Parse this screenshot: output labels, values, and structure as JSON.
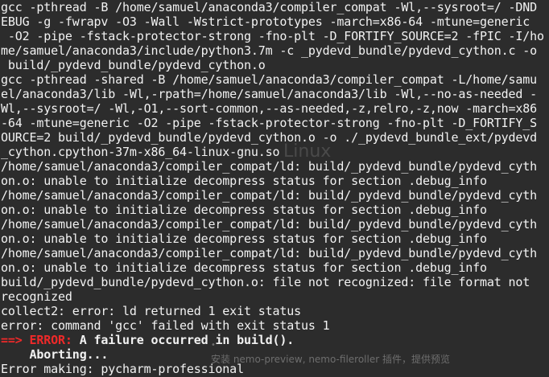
{
  "terminal": {
    "lines": [
      {
        "segments": [
          {
            "text": "gcc -pthread -B /home/samuel/anaconda3/compiler_compat -Wl,--sysroot=/ -DND"
          }
        ]
      },
      {
        "segments": [
          {
            "text": "EBUG -g -fwrapv -O3 -Wall -Wstrict-prototypes -march=x86-64 -mtune=generic"
          }
        ]
      },
      {
        "segments": [
          {
            "text": " -O2 -pipe -fstack-protector-strong -fno-plt -D_FORTIFY_SOURCE=2 -fPIC -I/ho"
          }
        ]
      },
      {
        "segments": [
          {
            "text": "me/samuel/anaconda3/include/python3.7m -c _pydevd_bundle/pydevd_cython.c -o"
          }
        ]
      },
      {
        "segments": [
          {
            "text": " build/_pydevd_bundle/pydevd_cython.o"
          }
        ]
      },
      {
        "segments": [
          {
            "text": "gcc -pthread -shared -B /home/samuel/anaconda3/compiler_compat -L/home/samu"
          }
        ]
      },
      {
        "segments": [
          {
            "text": "el/anaconda3/lib -Wl,-rpath=/home/samuel/anaconda3/lib -Wl,--no-as-needed -"
          }
        ]
      },
      {
        "segments": [
          {
            "text": "Wl,--sysroot=/ -Wl,-O1,--sort-common,--as-needed,-z,relro,-z,now -march=x86"
          }
        ]
      },
      {
        "segments": [
          {
            "text": "-64 -mtune=generic -O2 -pipe -fstack-protector-strong -fno-plt -D_FORTIFY_S"
          }
        ]
      },
      {
        "segments": [
          {
            "text": "OURCE=2 build/_pydevd_bundle/pydevd_cython.o -o ./_pydevd_bundle_ext/pydevd"
          }
        ]
      },
      {
        "segments": [
          {
            "text": "_cython.cpython-37m-x86_64-linux-gnu.so"
          }
        ]
      },
      {
        "segments": [
          {
            "text": "/home/samuel/anaconda3/compiler_compat/ld: build/_pydevd_bundle/pydevd_cyth"
          }
        ]
      },
      {
        "segments": [
          {
            "text": "on.o: unable to initialize decompress status for section .debug_info"
          }
        ]
      },
      {
        "segments": [
          {
            "text": "/home/samuel/anaconda3/compiler_compat/ld: build/_pydevd_bundle/pydevd_cyth"
          }
        ]
      },
      {
        "segments": [
          {
            "text": "on.o: unable to initialize decompress status for section .debug_info"
          }
        ]
      },
      {
        "segments": [
          {
            "text": "/home/samuel/anaconda3/compiler_compat/ld: build/_pydevd_bundle/pydevd_cyth"
          }
        ]
      },
      {
        "segments": [
          {
            "text": "on.o: unable to initialize decompress status for section .debug_info"
          }
        ]
      },
      {
        "segments": [
          {
            "text": "/home/samuel/anaconda3/compiler_compat/ld: build/_pydevd_bundle/pydevd_cyth"
          }
        ]
      },
      {
        "segments": [
          {
            "text": "on.o: unable to initialize decompress status for section .debug_info"
          }
        ]
      },
      {
        "segments": [
          {
            "text": "build/_pydevd_bundle/pydevd_cython.o: file not recognized: file format not"
          }
        ]
      },
      {
        "segments": [
          {
            "text": "recognized"
          }
        ]
      },
      {
        "segments": [
          {
            "text": "collect2: error: ld returned 1 exit status"
          }
        ]
      },
      {
        "segments": [
          {
            "text": "error: command 'gcc' failed with exit status 1"
          }
        ]
      },
      {
        "segments": [
          {
            "text": "==> ",
            "style": "arrow"
          },
          {
            "text": "ERROR:",
            "style": "error-tag"
          },
          {
            "text": " A failure occurred in build().",
            "style": "bold"
          }
        ]
      },
      {
        "segments": [
          {
            "text": "    Aborting...",
            "style": "bold"
          }
        ]
      },
      {
        "segments": [
          {
            "text": "Error making: pycharm-professional"
          }
        ]
      }
    ]
  },
  "watermark": {
    "linux": "Linux",
    "bullet": "•",
    "chinese": "安装 nemo-preview, nemo-fileroller 插件，提供预览"
  },
  "colors": {
    "background": "#2c2c2c",
    "foreground": "#f2f2f2",
    "error": "#ef2929"
  }
}
